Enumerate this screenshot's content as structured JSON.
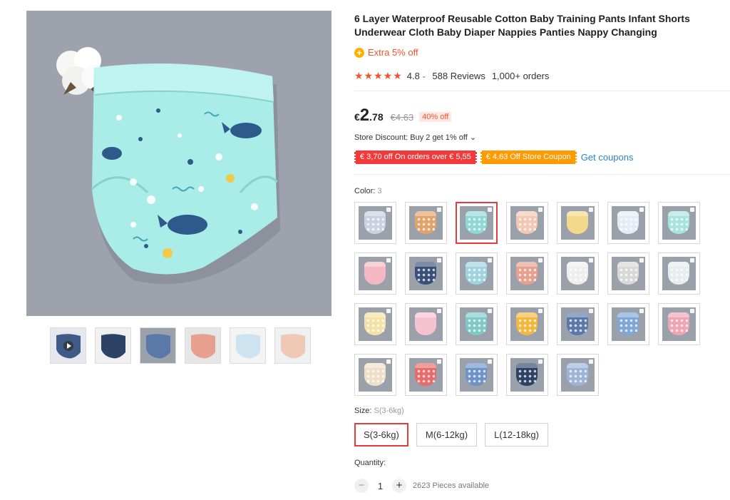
{
  "product": {
    "title": "6 Layer Waterproof Reusable Cotton Baby Training Pants Infant Shorts Underwear Cloth Baby Diaper Nappies Panties Nappy Changing",
    "extra_icon": "+",
    "extra_discount": "Extra 5% off",
    "stars": "★★★★★",
    "rating": "4.8",
    "rating_chevron": "⌄",
    "reviews": "588 Reviews",
    "orders": "1,000+ orders"
  },
  "price": {
    "currency": "€",
    "whole": "2",
    "fraction": ".78",
    "original": "€4.63",
    "discount_badge": "40% off"
  },
  "store": {
    "discount_text": "Store Discount: Buy 2 get 1% off ⌄",
    "coupon_red": "€ 3,70 off On orders over € 5,55",
    "coupon_orange": "€ 4,63 Off Store Coupon",
    "get_coupons": "Get coupons"
  },
  "color": {
    "label": "Color: ",
    "selected_value": "3",
    "swatches": [
      {
        "bg": "#c9d2de",
        "dot": true
      },
      {
        "bg": "#e0a36b",
        "dot": true
      },
      {
        "bg": "#8fd8d6",
        "dot": true
      },
      {
        "bg": "#f1c7b5",
        "dot": true
      },
      {
        "bg": "#f3d98a",
        "dot": false
      },
      {
        "bg": "#e6ecf3",
        "dot": true
      },
      {
        "bg": "#a8e3dd",
        "dot": true
      },
      {
        "bg": "#f5b8c2",
        "dot": false
      },
      {
        "bg": "#3a4f78",
        "dot": true
      },
      {
        "bg": "#9fd3e0",
        "dot": true
      },
      {
        "bg": "#e7a08e",
        "dot": true
      },
      {
        "bg": "#eeeeee",
        "dot": true
      },
      {
        "bg": "#d8d8d8",
        "dot": true
      },
      {
        "bg": "#e9ecef",
        "dot": true
      },
      {
        "bg": "#f3e1a8",
        "dot": true
      },
      {
        "bg": "#f7c2d0",
        "dot": false
      },
      {
        "bg": "#7ec8c6",
        "dot": true
      },
      {
        "bg": "#f0b83d",
        "dot": true
      },
      {
        "bg": "#5a79a8",
        "dot": true
      },
      {
        "bg": "#7ea6d6",
        "dot": true
      },
      {
        "bg": "#f0a5b4",
        "dot": true
      },
      {
        "bg": "#eee0c8",
        "dot": true
      },
      {
        "bg": "#e86b6b",
        "dot": true
      },
      {
        "bg": "#6d93c9",
        "dot": true
      },
      {
        "bg": "#2e4266",
        "dot": true
      },
      {
        "bg": "#9db4d9",
        "dot": true
      }
    ],
    "selected_index": 2
  },
  "size": {
    "label": "Size: ",
    "selected_value": "S(3-6kg)",
    "options": [
      "S(3-6kg)",
      "M(6-12kg)",
      "L(12-18kg)"
    ],
    "selected_index": 0
  },
  "quantity": {
    "label": "Quantity:",
    "minus": "−",
    "plus": "+",
    "value": "1",
    "available": "2623 Pieces available"
  },
  "gallery": {
    "thumbnails": [
      {
        "icon": "play-icon",
        "bg": "#e4e8ee",
        "pant": "#3f5a86"
      },
      {
        "icon": "image-icon",
        "bg": "#f0f0f0",
        "pant": "#2e4266"
      },
      {
        "icon": "image-icon",
        "bg": "#9aa1ab",
        "pant": "#5a79a8"
      },
      {
        "icon": "image-icon",
        "bg": "#e6e6e6",
        "pant": "#e8a08e"
      },
      {
        "icon": "image-icon",
        "bg": "#f3f3f3",
        "pant": "#cde3f0"
      },
      {
        "icon": "image-icon",
        "bg": "#eef0f2",
        "pant": "#f0c9b6"
      }
    ]
  },
  "colors": {
    "accent": "#e03d3d",
    "sale": "#f2552c",
    "link": "#2a83c7",
    "coupon_red": "#f23a3a",
    "coupon_orange": "#ff9a00"
  }
}
